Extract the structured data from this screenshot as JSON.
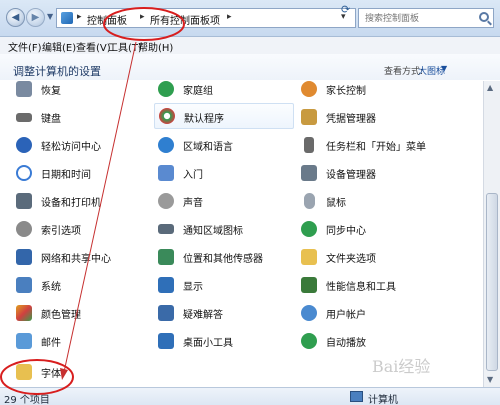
{
  "address_bar": {
    "crumbs": [
      "控制面板",
      "所有控制面板项"
    ],
    "search_placeholder": "搜索控制面板"
  },
  "menu": [
    "文件(F)",
    "编辑(E)",
    "查看(V)",
    "工具(T)",
    "帮助(H)"
  ],
  "header": {
    "title": "调整计算机的设置",
    "view_label": "查看方式:",
    "view_value": "大图标"
  },
  "items": {
    "col1": [
      {
        "label": "恢复",
        "icon": "recovery-icon",
        "color": "#7a8aa0"
      },
      {
        "label": "键盘",
        "icon": "keyboard-icon",
        "color": "#6b6b6b"
      },
      {
        "label": "轻松访问中心",
        "icon": "ease-of-access-icon",
        "color": "#2b63b8"
      },
      {
        "label": "日期和时间",
        "icon": "clock-icon",
        "color": "#3a7bd5"
      },
      {
        "label": "设备和打印机",
        "icon": "printer-icon",
        "color": "#5b6b7b"
      },
      {
        "label": "索引选项",
        "icon": "indexing-icon",
        "color": "#8a8a8a"
      },
      {
        "label": "网络和共享中心",
        "icon": "network-icon",
        "color": "#3366aa"
      },
      {
        "label": "系统",
        "icon": "system-icon",
        "color": "#4a7fbf"
      },
      {
        "label": "颜色管理",
        "icon": "color-management-icon",
        "color": "#e0a020"
      },
      {
        "label": "邮件",
        "icon": "mail-icon",
        "color": "#5a9ad8"
      },
      {
        "label": "字体",
        "icon": "font-folder-icon",
        "color": "#e8c050"
      }
    ],
    "col2": [
      {
        "label": "家庭组",
        "icon": "homegroup-icon",
        "color": "#2f9e4f"
      },
      {
        "label": "默认程序",
        "icon": "default-programs-icon",
        "color": "#2f9e4f"
      },
      {
        "label": "区域和语言",
        "icon": "globe-icon",
        "color": "#2f7fd0"
      },
      {
        "label": "入门",
        "icon": "getting-started-icon",
        "color": "#5a8ad0"
      },
      {
        "label": "声音",
        "icon": "speaker-icon",
        "color": "#9a9a9a"
      },
      {
        "label": "通知区域图标",
        "icon": "notification-icon",
        "color": "#5a6a7a"
      },
      {
        "label": "位置和其他传感器",
        "icon": "sensor-icon",
        "color": "#3a8a5a"
      },
      {
        "label": "显示",
        "icon": "display-icon",
        "color": "#2f6fb8"
      },
      {
        "label": "疑难解答",
        "icon": "troubleshoot-icon",
        "color": "#3a6aa8"
      },
      {
        "label": "桌面小工具",
        "icon": "gadgets-icon",
        "color": "#2f6fb8"
      }
    ],
    "col3": [
      {
        "label": "家长控制",
        "icon": "parental-controls-icon",
        "color": "#e08a30"
      },
      {
        "label": "凭据管理器",
        "icon": "credential-icon",
        "color": "#c89a40"
      },
      {
        "label": "任务栏和「开始」菜单",
        "icon": "taskbar-icon",
        "color": "#6a6a6a"
      },
      {
        "label": "设备管理器",
        "icon": "device-manager-icon",
        "color": "#6a7a8a"
      },
      {
        "label": "鼠标",
        "icon": "mouse-icon",
        "color": "#9aa4b0"
      },
      {
        "label": "同步中心",
        "icon": "sync-icon",
        "color": "#2f9e4f"
      },
      {
        "label": "文件夹选项",
        "icon": "folder-options-icon",
        "color": "#e8c050"
      },
      {
        "label": "性能信息和工具",
        "icon": "performance-icon",
        "color": "#3a7a3a"
      },
      {
        "label": "用户帐户",
        "icon": "user-accounts-icon",
        "color": "#4a8ad0"
      },
      {
        "label": "自动播放",
        "icon": "autoplay-icon",
        "color": "#2f9e4f"
      }
    ]
  },
  "status": {
    "count": "29 个项目",
    "location": "计算机"
  },
  "watermark": "Bai经验"
}
